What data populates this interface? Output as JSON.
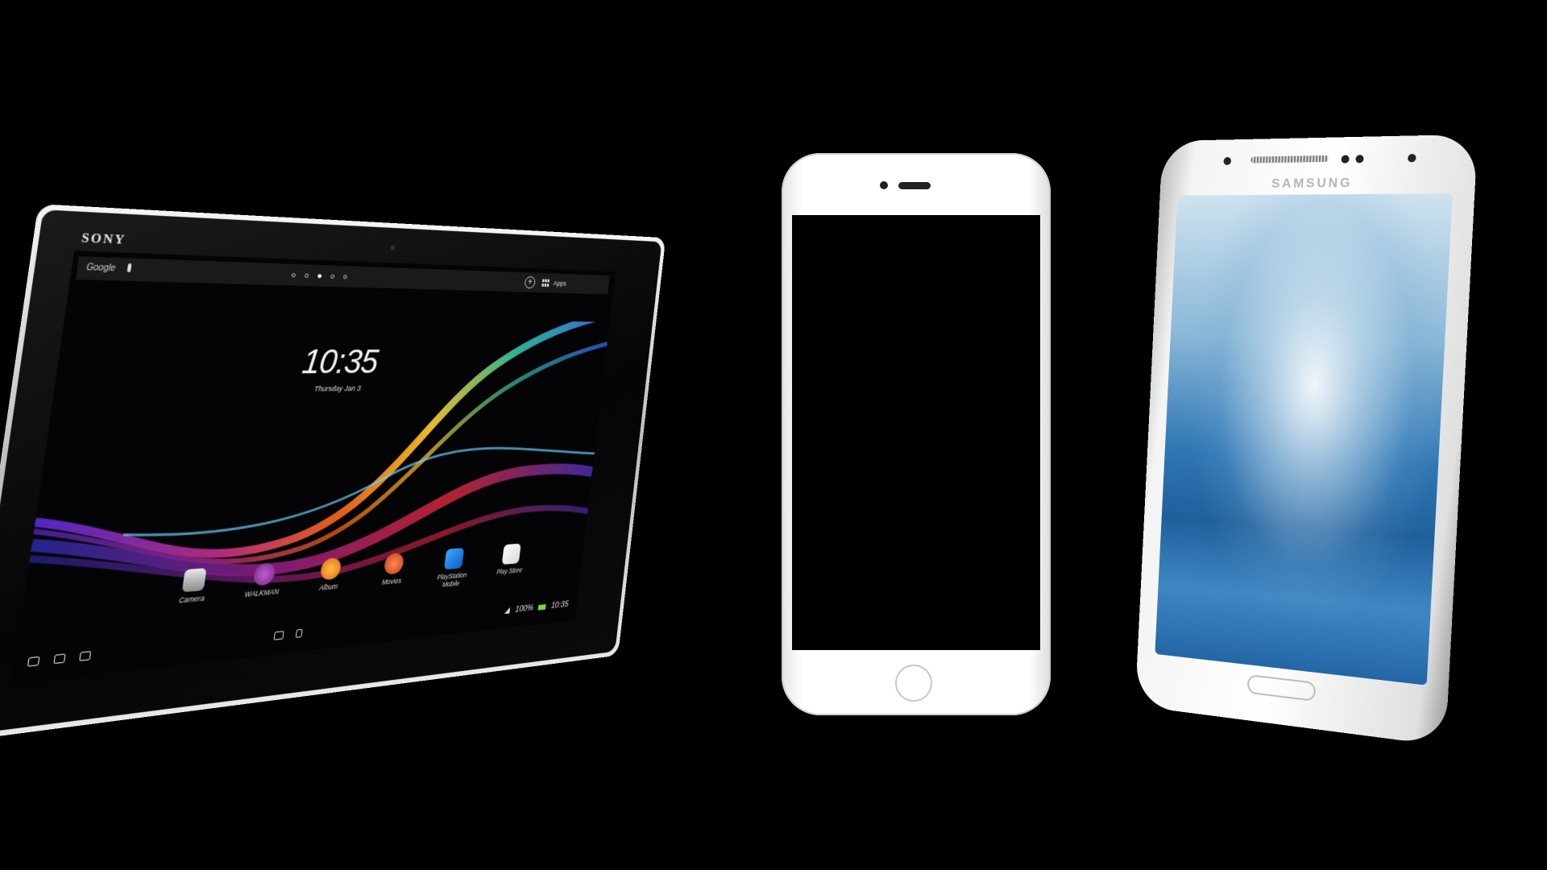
{
  "tablet": {
    "brand": "SONY",
    "search_label": "Google",
    "apps_label": "Apps",
    "clock": "10:35",
    "date": "Thursday Jan 3",
    "dock": [
      "Camera",
      "WALKMAN",
      "Album",
      "Movies",
      "PlayStation Mobile",
      "Play Store"
    ],
    "status_battery": "100%",
    "status_time": "10:35"
  },
  "samsung": {
    "brand": "SAMSUNG"
  }
}
